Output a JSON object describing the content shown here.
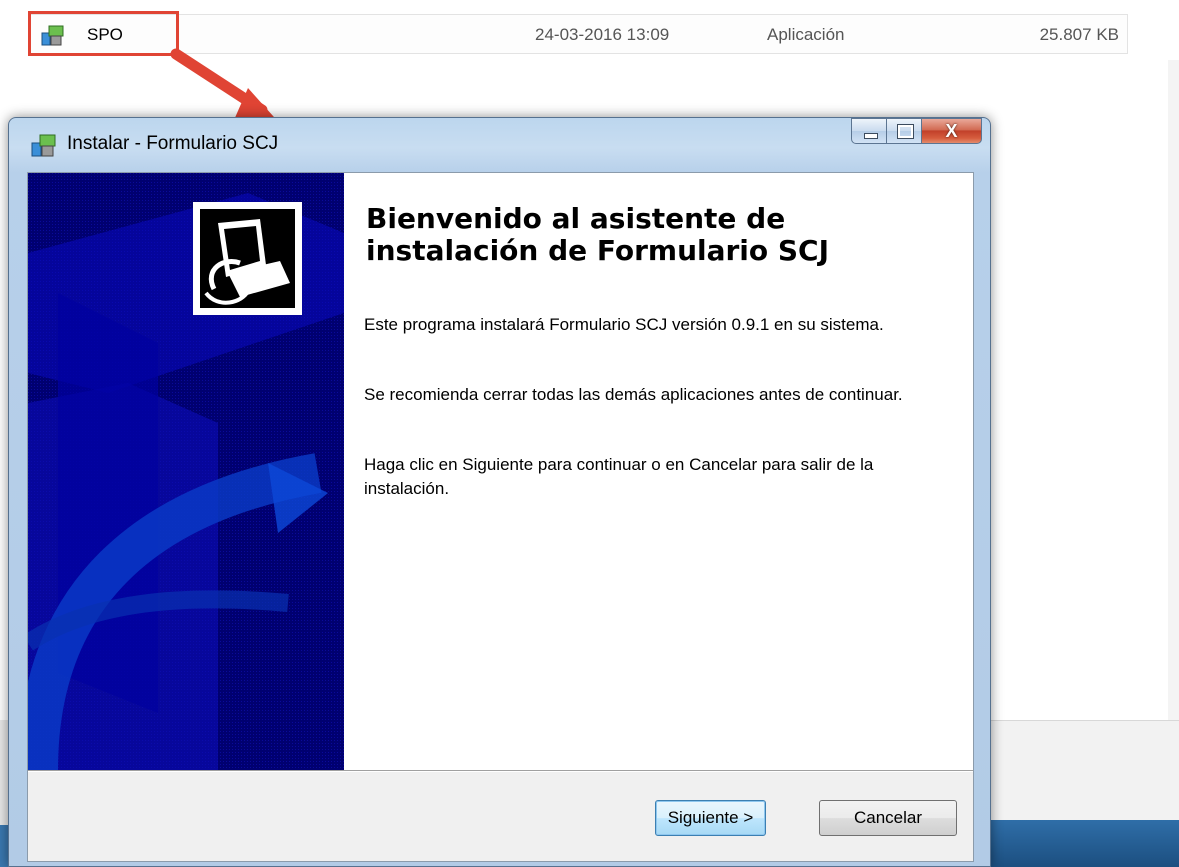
{
  "explorer": {
    "file": {
      "name": "SPO",
      "date": "24-03-2016 13:09",
      "type": "Aplicación",
      "size": "25.807 KB",
      "icon": "installer-icon"
    }
  },
  "dialog": {
    "title": "Instalar - Formulario SCJ",
    "icon": "installer-icon",
    "caption": {
      "close_label": "X"
    },
    "heading": "Bienvenido al asistente de instalación de Formulario SCJ",
    "paragraphs": [
      "Este programa instalará Formulario SCJ versión 0.9.1 en su sistema.",
      "Se recomienda cerrar todas las demás aplicaciones antes de continuar.",
      "Haga clic en Siguiente para continuar o en Cancelar para salir de la instalación."
    ],
    "buttons": {
      "next": "Siguiente >",
      "cancel": "Cancelar"
    }
  },
  "colors": {
    "highlight": "#e04434",
    "banner": "#000070",
    "titlebar": "#bcd6ee"
  }
}
